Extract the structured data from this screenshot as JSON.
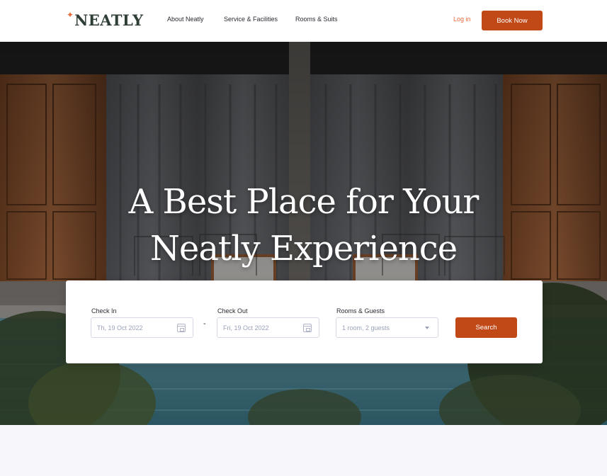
{
  "brand": {
    "name": "NEATLY",
    "star": "✦"
  },
  "nav": {
    "links": [
      "About Neatly",
      "Service & Facilities",
      "Rooms & Suits"
    ],
    "login": "Log in",
    "book_now": "Book Now"
  },
  "hero": {
    "headline_line1": "A Best Place for Your",
    "headline_line2": "Neatly Experience"
  },
  "booking": {
    "check_in_label": "Check In",
    "check_in_value": "Th, 19 Oct 2022",
    "separator": "-",
    "check_out_label": "Check Out",
    "check_out_value": "Fri, 19 Oct 2022",
    "rooms_label": "Rooms & Guests",
    "rooms_value": "1 room, 2 guests",
    "search_label": "Search"
  },
  "colors": {
    "accent": "#c14817",
    "brand_text": "#2f3e35",
    "login": "#e76b39"
  },
  "icons": {
    "date_picker": "calendar-icon",
    "dropdown": "caret-down-icon",
    "logo_mark": "sparkle-icon"
  }
}
